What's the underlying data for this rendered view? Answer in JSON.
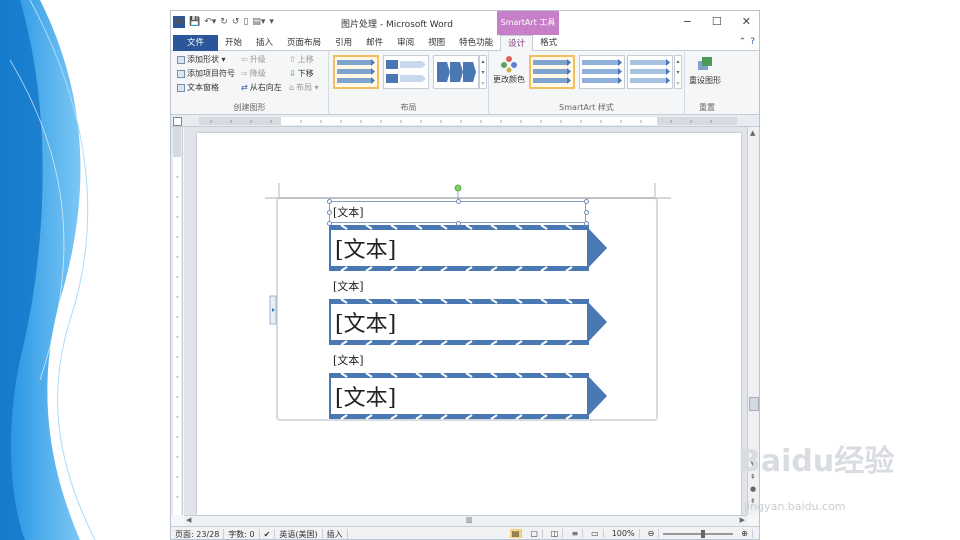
{
  "window": {
    "title": "图片处理 - Microsoft Word",
    "context_tab": "SmartArt 工具",
    "minimize": "−",
    "maximize": "☐",
    "close": "✕",
    "question": "?",
    "caret_up": "⌃"
  },
  "tabs": [
    {
      "label": "文件"
    },
    {
      "label": "开始"
    },
    {
      "label": "插入"
    },
    {
      "label": "页面布局"
    },
    {
      "label": "引用"
    },
    {
      "label": "邮件"
    },
    {
      "label": "审阅"
    },
    {
      "label": "视图"
    },
    {
      "label": "特色功能"
    },
    {
      "label": "设计"
    },
    {
      "label": "格式"
    }
  ],
  "ribbon": {
    "create_graphic": {
      "label": "创建图形",
      "add_shape": "添加形状 ▾",
      "add_bullet": "添加项目符号",
      "text_pane": "文本窗格",
      "promote": "升级",
      "demote": "降级",
      "right_to_left": "从右向左",
      "move_up": "上移",
      "move_down": "下移",
      "layout": "布局 ▾"
    },
    "layouts": {
      "label": "布局"
    },
    "styles": {
      "label": "SmartArt 样式",
      "change_colors": "更改颜色"
    },
    "reset": {
      "label": "重置",
      "reset_graphic": "重设图形"
    }
  },
  "smartart": {
    "label_text": "[文本]",
    "items": [
      {
        "small": "[文本]",
        "big": "[文本]"
      },
      {
        "small": "[文本]",
        "big": "[文本]"
      },
      {
        "small": "[文本]",
        "big": "[文本]"
      }
    ]
  },
  "status": {
    "page": "页面: 23/28",
    "words": "字数: 0",
    "language": "英语(美国)",
    "mode": "插入",
    "zoom": "100%"
  },
  "watermark": {
    "brand": "Baidu经验",
    "url": "jingyan.baidu.com"
  },
  "colors": {
    "accent": "#2b579a",
    "smartart": "#4a78b3",
    "context": "#c77fc8"
  }
}
